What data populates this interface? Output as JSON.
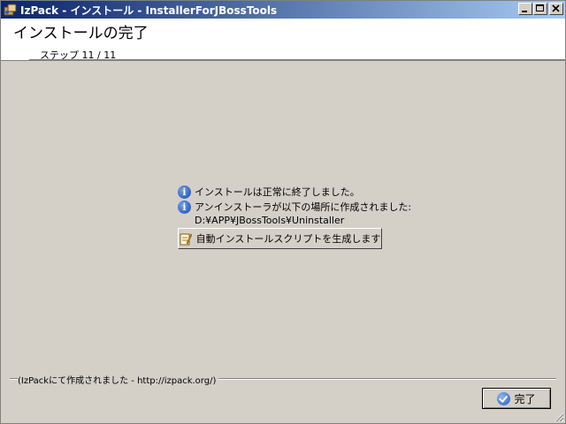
{
  "window": {
    "title": "IzPack - インストール - InstallerForJBossTools"
  },
  "header": {
    "title": "インストールの完了",
    "step": "ステップ 11 / 11"
  },
  "content": {
    "messages": [
      {
        "icon": "info-icon",
        "text": "インストールは正常に終了しました。"
      },
      {
        "icon": "info-icon",
        "text": "アンインストーラが以下の場所に作成されました:"
      }
    ],
    "uninstaller_path": "D:¥APP¥JBossTools¥Uninstaller",
    "generate_script_label": "自動インストールスクリプトを生成します"
  },
  "footer": {
    "made_with": "(IzPackにて作成されました - http://izpack.org/)",
    "done_label": "完了"
  },
  "colors": {
    "titlebar_start": "#0a246a",
    "titlebar_end": "#a6caf0",
    "panel_bg": "#d4d0c8"
  }
}
